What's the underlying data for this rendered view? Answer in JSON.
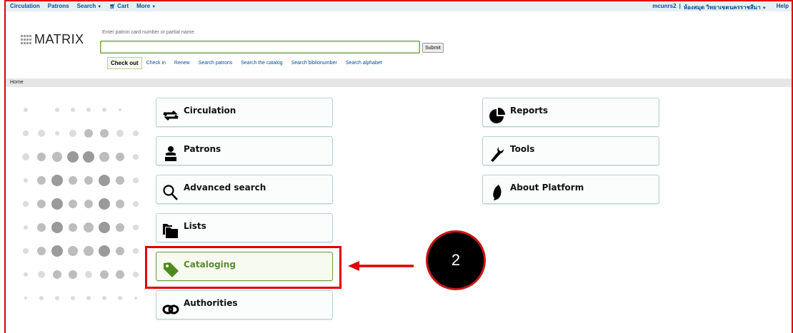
{
  "nav": {
    "items": [
      {
        "label": "Circulation",
        "dropdown": false
      },
      {
        "label": "Patrons",
        "dropdown": false
      },
      {
        "label": "Search",
        "dropdown": true
      },
      {
        "label": "Cart",
        "dropdown": false
      },
      {
        "label": "More",
        "dropdown": true
      }
    ],
    "user": "mcunrs2",
    "separator": "|",
    "library": "ห้องสมุด วิทยาเขตนครราชสีมา",
    "help": "Help"
  },
  "logo": {
    "text": "MATRIX"
  },
  "search": {
    "label": "Enter patron card number or partial name:",
    "value": "",
    "submit": "Submit"
  },
  "tabs": [
    "Check out",
    "Check in",
    "Renew",
    "Search patrons",
    "Search the catalog",
    "Search biblionumber",
    "Search alphabet"
  ],
  "breadcrumb": "Home",
  "modules_left": [
    {
      "label": "Circulation",
      "icon": "circulation-arrows-icon"
    },
    {
      "label": "Patrons",
      "icon": "patron-icon"
    },
    {
      "label": "Advanced search",
      "icon": "magnifier-icon"
    },
    {
      "label": "Lists",
      "icon": "folders-icon"
    },
    {
      "label": "Cataloging",
      "icon": "tag-icon"
    },
    {
      "label": "Authorities",
      "icon": "link-icon"
    }
  ],
  "modules_right": [
    {
      "label": "Reports",
      "icon": "pie-chart-icon"
    },
    {
      "label": "Tools",
      "icon": "wrench-icon"
    },
    {
      "label": "About Platform",
      "icon": "flame-icon"
    }
  ],
  "annotation": {
    "step": "2",
    "color": "#e00000"
  },
  "colors": {
    "link": "#004d99",
    "accent_green": "#6a9a3e",
    "highlight_red": "#e00000"
  }
}
